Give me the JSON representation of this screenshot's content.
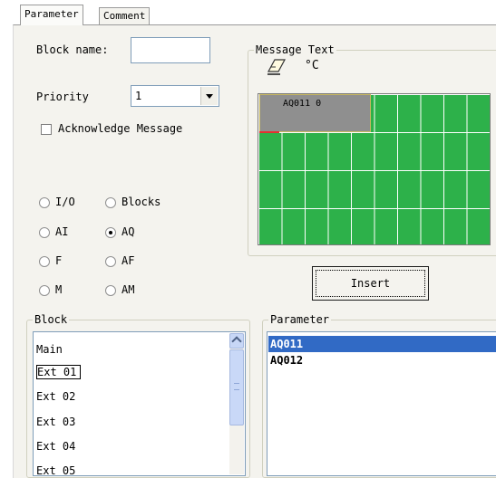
{
  "tabs": [
    {
      "label": "Parameter",
      "active": true
    },
    {
      "label": "Comment",
      "active": false
    }
  ],
  "block_name": {
    "label": "Block name:",
    "value": ""
  },
  "priority": {
    "label": "Priority",
    "value": "1"
  },
  "acknowledge": {
    "label": "Acknowledge Message",
    "checked": false
  },
  "radios": [
    {
      "label": "I/O",
      "checked": false
    },
    {
      "label": "Blocks",
      "checked": false
    },
    {
      "label": "AI",
      "checked": false
    },
    {
      "label": "AQ",
      "checked": true
    },
    {
      "label": "F",
      "checked": false
    },
    {
      "label": "AF",
      "checked": false
    },
    {
      "label": "M",
      "checked": false
    },
    {
      "label": "AM",
      "checked": false
    }
  ],
  "message_text": {
    "title": "Message Text",
    "degree_label": "°C",
    "cell_text": "AQ011 0",
    "accent_color": "#2db14a",
    "icons": [
      "eraser-icon"
    ]
  },
  "insert_button": {
    "label": "Insert"
  },
  "block_list": {
    "title": "Block",
    "items": [
      "Main",
      "Ext 01",
      "Ext 02",
      "Ext 03",
      "Ext 04",
      "Ext 05"
    ],
    "focused": "Ext 01"
  },
  "parameter_list": {
    "title": "Parameter",
    "items": [
      "AQ011",
      "AQ012"
    ],
    "selected": "AQ011",
    "selection_color": "#316ac5"
  }
}
